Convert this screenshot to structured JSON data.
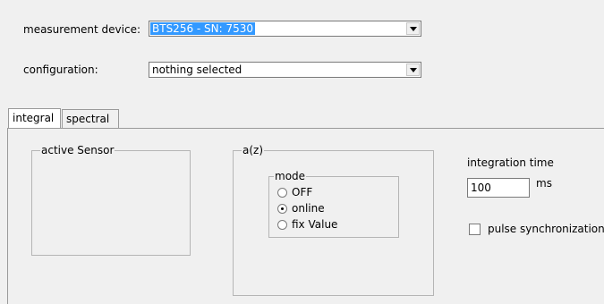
{
  "measurement": {
    "label": "measurement device:",
    "value": "BTS256 - SN: 7530"
  },
  "configuration": {
    "label": "configuration:",
    "value": "nothing selected"
  },
  "tabs": [
    {
      "label": "integral"
    },
    {
      "label": "spectral"
    }
  ],
  "active_sensor": {
    "title": "active Sensor"
  },
  "az": {
    "title": "a(z)",
    "mode": {
      "title": "mode",
      "options": [
        "OFF",
        "online",
        "fix Value"
      ],
      "selected": "online"
    }
  },
  "integration": {
    "label": "integration time",
    "value": "100",
    "unit": "ms"
  },
  "pulse_sync": {
    "label": "pulse synchronization",
    "checked": false
  },
  "colors": {
    "background": "#f0f0f0",
    "selection": "#3399ff"
  }
}
